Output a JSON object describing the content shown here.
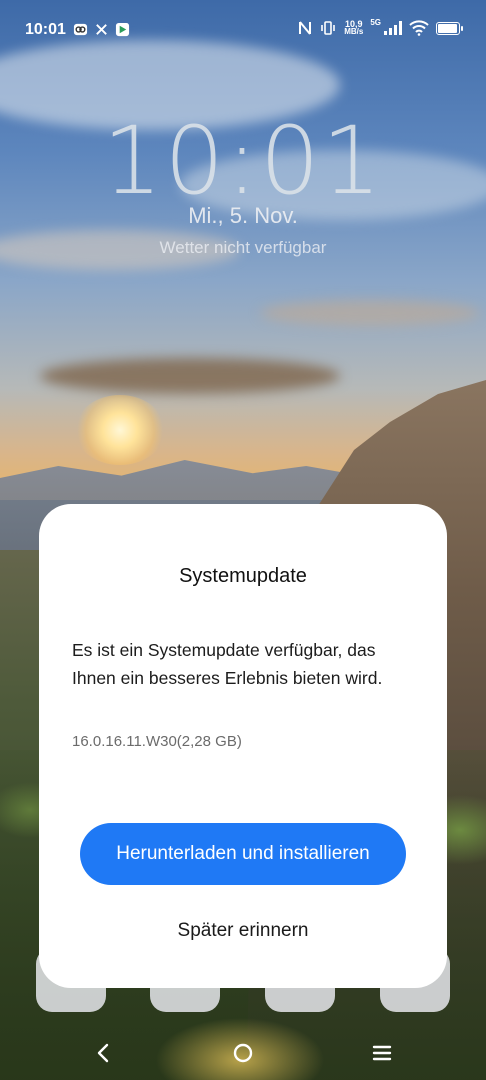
{
  "status_bar": {
    "time": "10:01",
    "net_speed_value": "10,9",
    "net_speed_unit": "MB/s",
    "network_type": "5G",
    "battery_percent": 95,
    "left_icons": [
      "notification-circle-icon",
      "x-icon",
      "play-store-icon"
    ],
    "right_icons": [
      "nfc-icon",
      "vibrate-icon",
      "signal-icon",
      "wifi-icon",
      "battery-icon"
    ]
  },
  "lock_screen": {
    "clock": "10:01",
    "date": "Mi., 5. Nov.",
    "weather": "Wetter nicht verfügbar"
  },
  "dialog": {
    "title": "Systemupdate",
    "message": "Es ist ein Systemupdate verfügbar, das Ihnen ein besseres Erlebnis bieten wird.",
    "version": "16.0.16.11.W30(2,28 GB)",
    "primary_button": "Herunterladen und installieren",
    "secondary_button": "Später erinnern"
  },
  "nav_bar": {
    "icons": [
      "back-icon",
      "home-icon",
      "menu-icon"
    ]
  },
  "colors": {
    "accent": "#1f79f5",
    "dialog_bg": "#ffffff"
  }
}
